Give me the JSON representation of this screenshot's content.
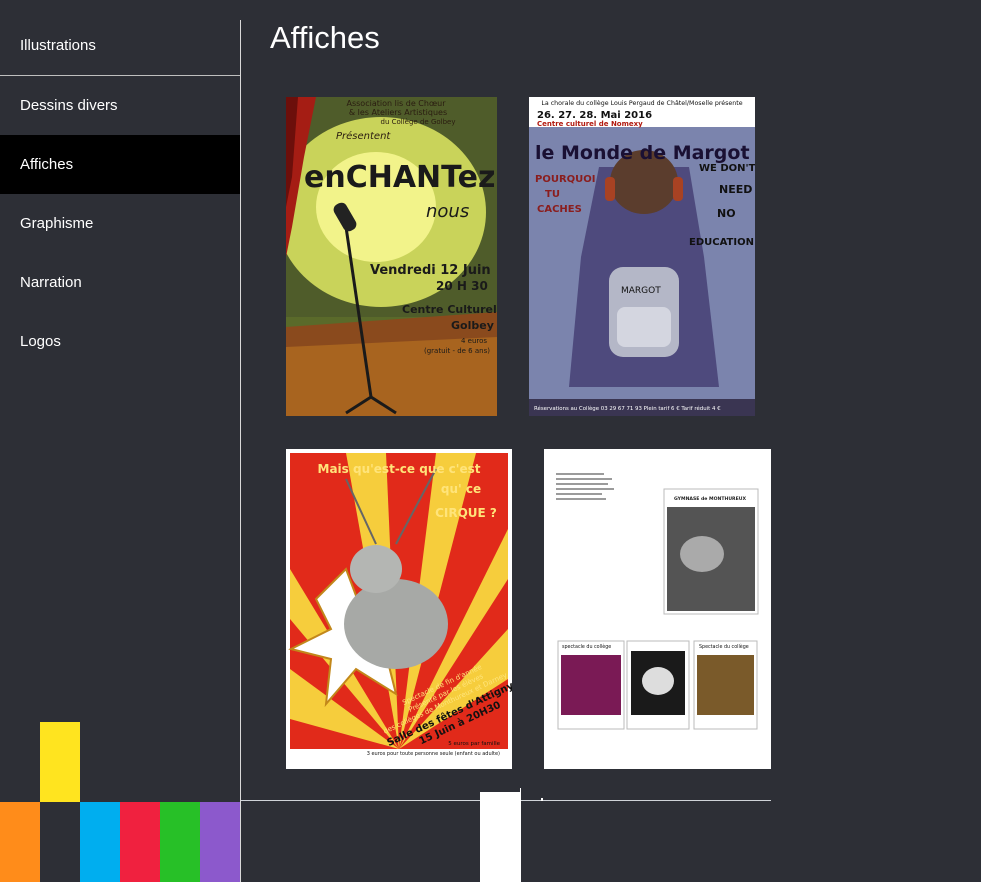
{
  "nav": {
    "items": [
      {
        "label": "Illustrations"
      },
      {
        "label": "Dessins divers"
      },
      {
        "label": "Affiches",
        "active": true
      },
      {
        "label": "Graphisme"
      },
      {
        "label": "Narration"
      },
      {
        "label": "Logos"
      }
    ]
  },
  "page": {
    "title": "Affiches"
  },
  "posters": {
    "enchantez": {
      "line1": "Association lis de Chœur",
      "line2": "& les Ateliers Artistiques",
      "line3": "du Collège de Golbey",
      "presentent": "Présentent",
      "headline": "enCHANTez",
      "sub": "nous",
      "date": "Vendredi 12 Juin",
      "time": "20 H 30",
      "venue1": "Centre Culturel",
      "venue2": "Golbey",
      "price1": "4 euros",
      "price2": "(gratuit - de 6 ans)"
    },
    "margot": {
      "top": "La chorale du collège Louis Pergaud de Châtel/Moselle présente",
      "dates": "26. 27. 28. Mai 2016",
      "place": "Centre culturel de Nomexy",
      "headline": "le Monde de Margot",
      "left1": "POURQUOI",
      "left2": "TU",
      "left3": "CACHES",
      "right1": "WE DON'T",
      "right2": "NEED",
      "right3": "NO",
      "right4": "EDUCATION !",
      "bag": "MARGOT",
      "footer": "Réservations au Collège  03 29 67 71 93   Plein tarif 6 €   Tarif réduit 4 €"
    },
    "cirque": {
      "headline1": "Mais qu'est-ce que c'est",
      "headline2": "qu' ce",
      "headline3": "CIRQUE ?",
      "info1": "Spectacle de fin d'année",
      "info2": "Présenté par les élèves",
      "info3": "des collèges de Monthureux et Darney",
      "venue": "Salle des fêtes d'Attigny",
      "date": "15 Juin à 20H30",
      "price1": "5 euros par famille",
      "price2": "3 euros pour toute personne seule (enfant ou adulte)"
    },
    "gymnase": {
      "heading1": "GYMNASE de MONTHUREUX",
      "heading2": "VENDREDI 20 JUIN à 20H30",
      "thumb1": "spectacle du collège",
      "thumb3": "Spectacle du collège"
    }
  },
  "colors": {
    "background": "#2d2f36",
    "active_nav": "#000000",
    "swatch_orange": "#ff8c1a",
    "swatch_yellow": "#ffe41f",
    "swatch_blue": "#00aeef",
    "swatch_red": "#f0213f",
    "swatch_green": "#27c027",
    "swatch_purple": "#8c59cc"
  }
}
